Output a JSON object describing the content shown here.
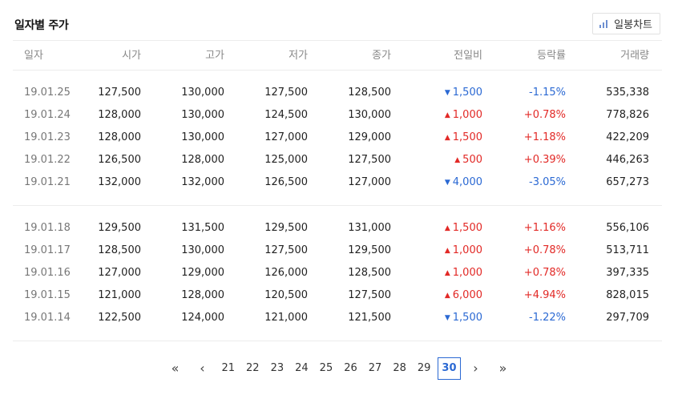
{
  "header": {
    "title": "일자별 주가",
    "chart_button_label": "일봉차트",
    "chart_icon": "bar-chart-icon"
  },
  "columns": [
    "일자",
    "시가",
    "고가",
    "저가",
    "종가",
    "전일비",
    "등락률",
    "거래량"
  ],
  "groups": [
    [
      {
        "date": "19.01.25",
        "open": "127,500",
        "high": "130,000",
        "low": "127,500",
        "close": "128,500",
        "dir": "down",
        "change": "1,500",
        "rate": "-1.15%",
        "volume": "535,338"
      },
      {
        "date": "19.01.24",
        "open": "128,000",
        "high": "130,000",
        "low": "124,500",
        "close": "130,000",
        "dir": "up",
        "change": "1,000",
        "rate": "+0.78%",
        "volume": "778,826"
      },
      {
        "date": "19.01.23",
        "open": "128,000",
        "high": "130,000",
        "low": "127,000",
        "close": "129,000",
        "dir": "up",
        "change": "1,500",
        "rate": "+1.18%",
        "volume": "422,209"
      },
      {
        "date": "19.01.22",
        "open": "126,500",
        "high": "128,000",
        "low": "125,000",
        "close": "127,500",
        "dir": "up",
        "change": "500",
        "rate": "+0.39%",
        "volume": "446,263"
      },
      {
        "date": "19.01.21",
        "open": "132,000",
        "high": "132,000",
        "low": "126,500",
        "close": "127,000",
        "dir": "down",
        "change": "4,000",
        "rate": "-3.05%",
        "volume": "657,273"
      }
    ],
    [
      {
        "date": "19.01.18",
        "open": "129,500",
        "high": "131,500",
        "low": "129,500",
        "close": "131,000",
        "dir": "up",
        "change": "1,500",
        "rate": "+1.16%",
        "volume": "556,106"
      },
      {
        "date": "19.01.17",
        "open": "128,500",
        "high": "130,000",
        "low": "127,500",
        "close": "129,500",
        "dir": "up",
        "change": "1,000",
        "rate": "+0.78%",
        "volume": "513,711"
      },
      {
        "date": "19.01.16",
        "open": "127,000",
        "high": "129,000",
        "low": "126,000",
        "close": "128,500",
        "dir": "up",
        "change": "1,000",
        "rate": "+0.78%",
        "volume": "397,335"
      },
      {
        "date": "19.01.15",
        "open": "121,000",
        "high": "128,000",
        "low": "120,500",
        "close": "127,500",
        "dir": "up",
        "change": "6,000",
        "rate": "+4.94%",
        "volume": "828,015"
      },
      {
        "date": "19.01.14",
        "open": "122,500",
        "high": "124,000",
        "low": "121,000",
        "close": "121,500",
        "dir": "down",
        "change": "1,500",
        "rate": "-1.22%",
        "volume": "297,709"
      }
    ]
  ],
  "arrows": {
    "up": "▲",
    "down": "▼"
  },
  "colors": {
    "up": "#e22926",
    "down": "#2b69d3",
    "active_page": "#2b69d3"
  },
  "pagination": {
    "first": "«",
    "prev": "‹",
    "pages": [
      "21",
      "22",
      "23",
      "24",
      "25",
      "26",
      "27",
      "28",
      "29",
      "30"
    ],
    "current": "30",
    "next": "›",
    "last": "»"
  }
}
